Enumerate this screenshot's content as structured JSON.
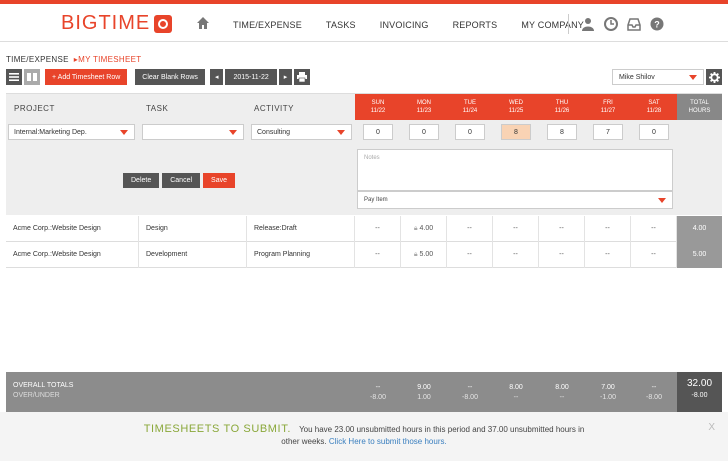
{
  "app": {
    "logo_text": "BIGTIME"
  },
  "nav": {
    "links": [
      "TIME/EXPENSE",
      "TASKS",
      "INVOICING",
      "REPORTS",
      "MY COMPANY"
    ],
    "icons": [
      "home-icon",
      "user-icon",
      "clock-icon",
      "inbox-icon",
      "help-icon"
    ]
  },
  "breadcrumb": {
    "parent": "TIME/EXPENSE",
    "current": "MY TIMESHEET"
  },
  "toolbar": {
    "add_row_label": "+ Add Timesheet Row",
    "clear_blank_label": "Clear Blank Rows",
    "date_value": "2015-11-22",
    "user_value": "Mike Shilov"
  },
  "table": {
    "headers": {
      "project": "PROJECT",
      "task": "TASK",
      "activity": "ACTIVITY"
    },
    "days": [
      {
        "name": "SUN",
        "date": "11/22"
      },
      {
        "name": "MON",
        "date": "11/23"
      },
      {
        "name": "TUE",
        "date": "11/24"
      },
      {
        "name": "WED",
        "date": "11/25"
      },
      {
        "name": "THU",
        "date": "11/26"
      },
      {
        "name": "FRI",
        "date": "11/27"
      },
      {
        "name": "SAT",
        "date": "11/28"
      }
    ],
    "total_header_1": "TOTAL",
    "total_header_2": "HOURS"
  },
  "entry": {
    "project_value": "Internal:Marketing Dep.",
    "task_value": "",
    "activity_value": "Consulting",
    "hours": [
      "0",
      "0",
      "0",
      "8",
      "8",
      "7",
      "0"
    ],
    "notes_placeholder": "Notes",
    "pay_item_label": "Pay Item",
    "delete_label": "Delete",
    "cancel_label": "Cancel",
    "save_label": "Save"
  },
  "rows": [
    {
      "project": "Acme Corp.:Website Design",
      "task": "Design",
      "activity": "Release:Draft",
      "hours": [
        "--",
        "4.00",
        "--",
        "--",
        "--",
        "--",
        "--"
      ],
      "total": "4.00"
    },
    {
      "project": "Acme Corp.:Website Design",
      "task": "Development",
      "activity": "Program Planning",
      "hours": [
        "--",
        "5.00",
        "--",
        "--",
        "--",
        "--",
        "--"
      ],
      "total": "5.00"
    }
  ],
  "totals": {
    "label": "OVERALL TOTALS",
    "sub_label": "OVER/UNDER",
    "values": [
      "--",
      "9.00",
      "--",
      "8.00",
      "8.00",
      "7.00",
      "--"
    ],
    "over_under": [
      "-8.00",
      "1.00",
      "-8.00",
      "--",
      "--",
      "-1.00",
      "-8.00"
    ],
    "grand_total": "32.00",
    "grand_over_under": "-8.00"
  },
  "submit": {
    "heading": "TIMESHEETS TO SUBMIT.",
    "message": "You have 23.00 unsubmitted hours in this period and 37.00 unsubmitted hours in",
    "message2": "other weeks.",
    "link": "Click Here to submit those hours.",
    "close": "X"
  },
  "colors": {
    "accent": "#e8442a",
    "green": "#8aa83a",
    "link": "#3a7fbf"
  }
}
